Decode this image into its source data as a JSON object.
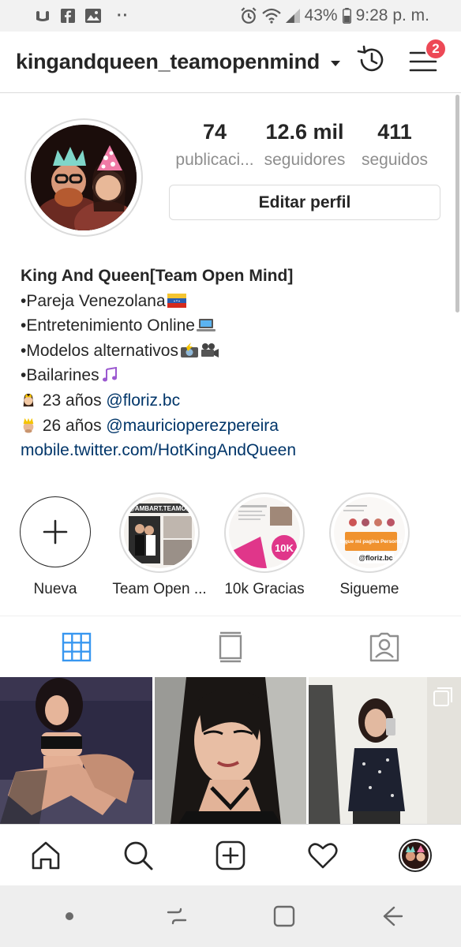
{
  "status_bar": {
    "battery": "43%",
    "time": "9:28 p. m.",
    "more": "··"
  },
  "header": {
    "username": "kingandqueen_teamopenmind",
    "notification_count": "2"
  },
  "profile": {
    "stats": [
      {
        "value": "74",
        "label": "publicaci..."
      },
      {
        "value": "12.6 mil",
        "label": "seguidores"
      },
      {
        "value": "411",
        "label": "seguidos"
      }
    ],
    "edit_button": "Editar perfil"
  },
  "bio": {
    "name": "King And Queen[Team Open Mind]",
    "lines": [
      "•Pareja Venezolana",
      "•Entretenimiento Online",
      "•Modelos alternativos",
      "•Bailarines"
    ],
    "age_lines": [
      {
        "text": " 23 años ",
        "mention": "@floriz.bc"
      },
      {
        "text": " 26 años ",
        "mention": "@mauricioperezpereira"
      }
    ],
    "link": "mobile.twitter.com/HotKingAndQueen"
  },
  "highlights": [
    {
      "label": "Nueva"
    },
    {
      "label": "Team Open ..."
    },
    {
      "label": "10k Gracias"
    },
    {
      "label": "Sigueme"
    }
  ],
  "highlight_text": {
    "team_open": "@AMBART.TEAMOP",
    "tenk": "10K",
    "sigueme_banner": "Sigue mi pagina Personal",
    "sigueme_handle": "@floriz.bc"
  },
  "colors": {
    "accent": "#3897f0",
    "badge": "#ed4956",
    "text": "#262626",
    "muted": "#8e8e8e",
    "border": "#dbdbdb"
  }
}
